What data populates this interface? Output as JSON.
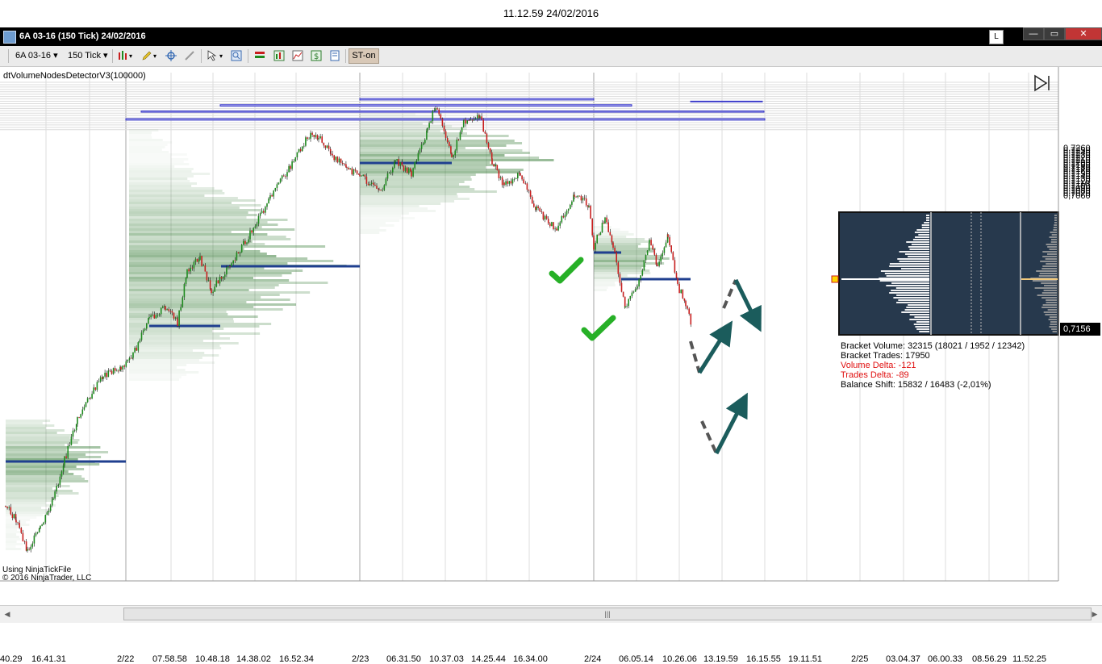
{
  "screen": {
    "timestamp": "11.12.59 24/02/2016"
  },
  "window": {
    "title": "6A 03-16 (150 Tick)  24/02/2016",
    "lock_button": "L",
    "minimize": "—",
    "maximize": "▭",
    "close": "✕"
  },
  "toolbar": {
    "instrument": "6A 03-16",
    "interval": "150 Tick",
    "strategy_button": "ST-on"
  },
  "indicator": {
    "label": "dtVolumeNodesDetectorV3(100000)"
  },
  "footer": {
    "data_source": "Using NinjaTickFile",
    "copyright": "© 2016 NinjaTrader, LLC"
  },
  "price_axis": {
    "labels": [
      "0,7260",
      "0,7250",
      "0,7240",
      "0,7230",
      "0,7220",
      "0,7210",
      "0,7200",
      "0,7190",
      "0,7180",
      "0,7170",
      "0,7160",
      "0,7150",
      "0,7140",
      "0,7130",
      "0,7120",
      "0,7110",
      "0,7100",
      "0,7090",
      "0,7080",
      "0,7070",
      "0,7060"
    ],
    "last_price": "0,7156"
  },
  "time_axis": {
    "labels": [
      "40.29",
      "16.41.31",
      "2/22",
      "07.58.58",
      "10.48.18",
      "14.38.02",
      "16.52.34",
      "2/23",
      "06.31.50",
      "10.37.03",
      "14.25.44",
      "16.34.00",
      "2/24",
      "06.05.14",
      "10.26.06",
      "13.19.59",
      "16.15.55",
      "19.11.51",
      "2/25",
      "03.04.37",
      "06.00.33",
      "08.56.29",
      "11.52.25"
    ]
  },
  "chart_data": {
    "type": "candlestick",
    "ylim": [
      0.7055,
      0.7265
    ],
    "volume_node_zones": [
      {
        "top": 0.71915,
        "bottom": 0.71855
      },
      {
        "top": 0.71655,
        "bottom": 0.71595
      },
      {
        "top": 0.7139,
        "bottom": 0.7134
      },
      {
        "top": 0.7107,
        "bottom": 0.71005
      },
      {
        "top": 0.71805,
        "bottom": 0.71775
      }
    ],
    "colors": {
      "up_candle": "#1e8a1e",
      "down_candle": "#c81e1e",
      "zone_fill": "#c6c6f6",
      "zone_border": "#3535c8",
      "volume_profile": "#1d6b1d",
      "arrow": "#1b5c5c",
      "checkmark": "#27b027"
    }
  },
  "bracket_stats": {
    "bracket_volume": "Bracket Volume: 32315 (18021 / 1952 / 12342)",
    "bracket_trades": "Bracket Trades: 17950",
    "volume_delta": "Volume Delta: -121",
    "trades_delta": "Trades Delta: -89",
    "balance_shift": "Balance Shift: 15832 / 16483 (-2,01%)"
  }
}
